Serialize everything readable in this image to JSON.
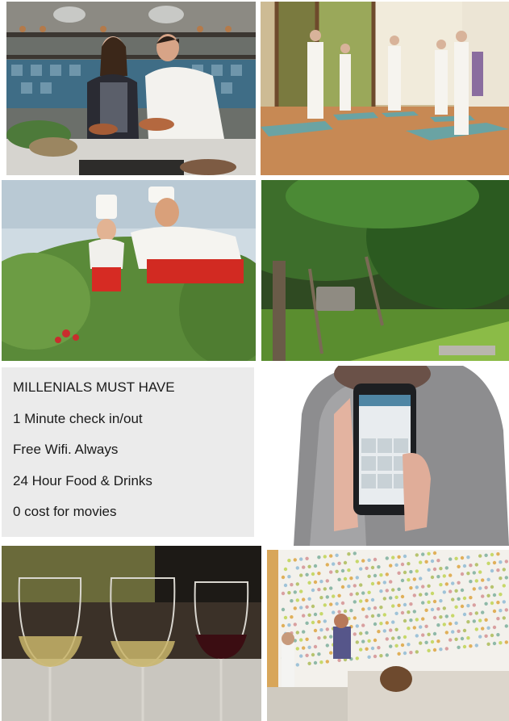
{
  "tiles": [
    {
      "id": "kitchen",
      "caption": ""
    },
    {
      "id": "yoga",
      "caption": ""
    },
    {
      "id": "garden",
      "caption": ""
    },
    {
      "id": "swing",
      "caption": ""
    },
    {
      "id": "phone",
      "caption": ""
    },
    {
      "id": "wine",
      "caption": ""
    },
    {
      "id": "wall",
      "caption": ""
    }
  ],
  "text_card": {
    "heading": "MILLENIALS MUST HAVE",
    "items": [
      "1 Minute check in/out",
      "Free Wifi. Always",
      "24 Hour Food & Drinks",
      "0 cost for movies"
    ]
  },
  "colors": {
    "card_background": "#ebebeb",
    "text": "#1a1a1a"
  }
}
